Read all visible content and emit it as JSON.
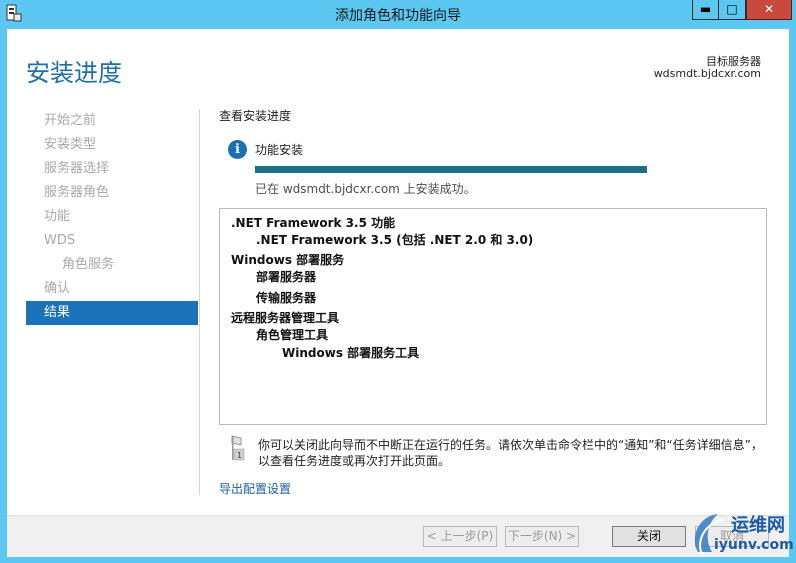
{
  "window": {
    "title": "添加角色和功能向导",
    "controls": {
      "minimize": "▬",
      "maximize": "□",
      "close": "✕"
    }
  },
  "header": {
    "page_title": "安装进度",
    "target_label": "目标服务器",
    "target_server": "wdsmdt.bjdcxr.com"
  },
  "nav": {
    "items": [
      {
        "label": "开始之前",
        "active": false
      },
      {
        "label": "安装类型",
        "active": false
      },
      {
        "label": "服务器选择",
        "active": false
      },
      {
        "label": "服务器角色",
        "active": false
      },
      {
        "label": "功能",
        "active": false
      },
      {
        "label": "WDS",
        "active": false
      },
      {
        "label": "角色服务",
        "active": false,
        "sub": true
      },
      {
        "label": "确认",
        "active": false
      },
      {
        "label": "结果",
        "active": true
      }
    ]
  },
  "content": {
    "section_label": "查看安装进度",
    "feature_install_label": "功能安装",
    "progress_percent": 100,
    "status_text": "已在 wdsmdt.bjdcxr.com 上安装成功。",
    "results": [
      {
        "text": ".NET Framework 3.5 功能",
        "level": 0
      },
      {
        "text": ".NET Framework 3.5 (包括 .NET 2.0 和 3.0)",
        "level": 1
      },
      {
        "text": "Windows 部署服务",
        "level": 0
      },
      {
        "text": "部署服务器",
        "level": 1
      },
      {
        "text": "传输服务器",
        "level": 1
      },
      {
        "text": "远程服务器管理工具",
        "level": 0
      },
      {
        "text": "角色管理工具",
        "level": 1
      },
      {
        "text": "Windows 部署服务工具",
        "level": 2
      }
    ],
    "footer_note": "你可以关闭此向导而不中断正在运行的任务。请依次单击命令栏中的“通知”和“任务详细信息”，以查看任务进度或再次打开此页面。",
    "export_link": "导出配置设置"
  },
  "buttons": {
    "prev": "< 上一步(P)",
    "next": "下一步(N) >",
    "close": "关闭",
    "cancel": "取消"
  },
  "watermark": {
    "name": "运维网",
    "url": "iyunv.com"
  },
  "colors": {
    "titlebar": "#5cc7f0",
    "accent": "#1a73b8",
    "progress": "#1b6f86",
    "close_button": "#c74a3e"
  }
}
